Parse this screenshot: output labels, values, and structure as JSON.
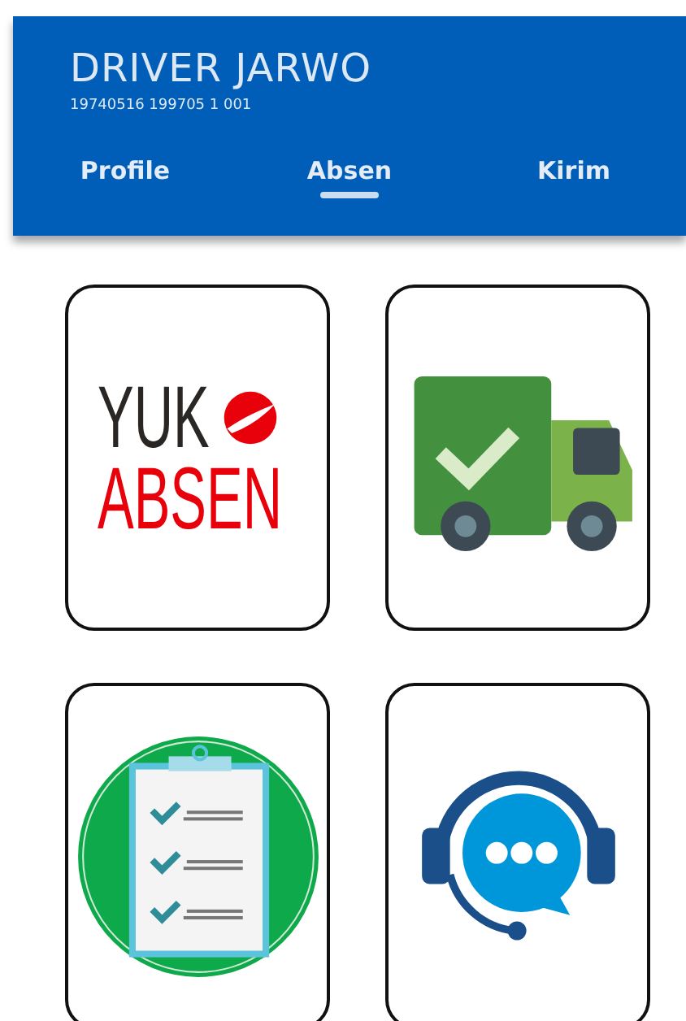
{
  "header": {
    "name": "DRIVER JARWO",
    "id_number": "19740516 199705 1 001"
  },
  "tabs": [
    {
      "label": "Profile",
      "selected": false
    },
    {
      "label": "Absen",
      "selected": true
    },
    {
      "label": "Kirim",
      "selected": false
    }
  ],
  "tiles": [
    {
      "kind": "logo",
      "top_text": "YUK",
      "bottom_text": "ABSEN"
    },
    {
      "kind": "truck"
    },
    {
      "kind": "checklist"
    },
    {
      "kind": "support"
    }
  ]
}
